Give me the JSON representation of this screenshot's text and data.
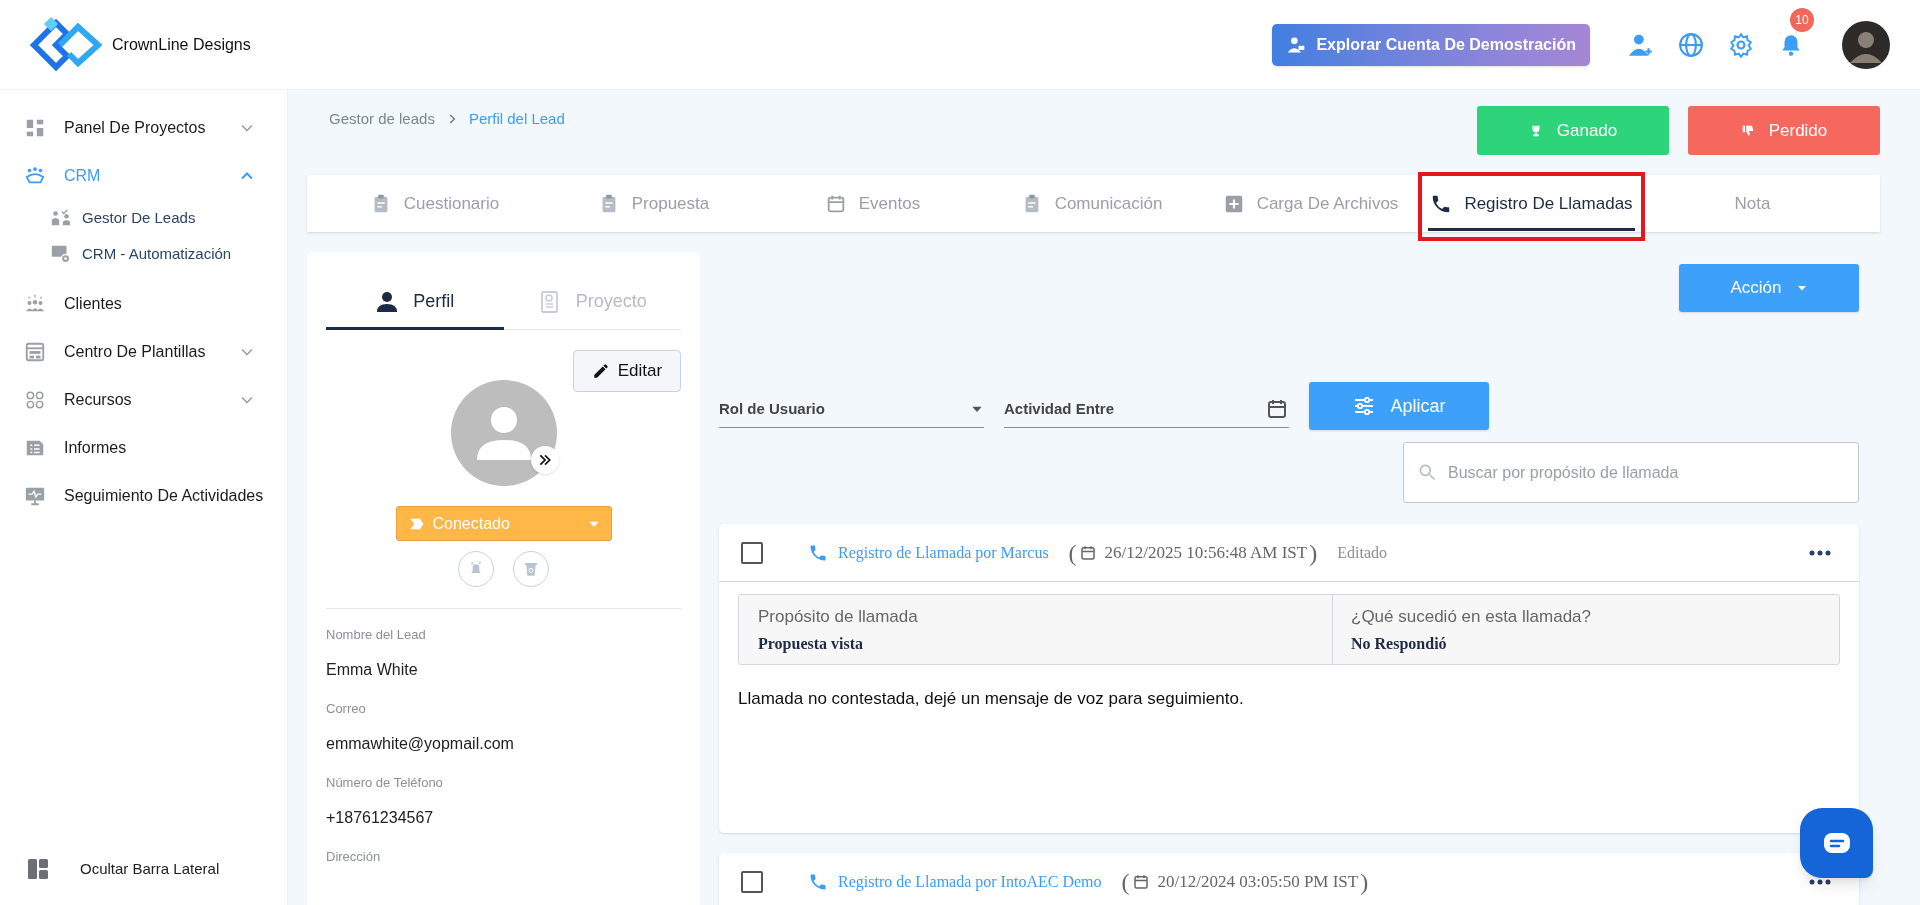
{
  "brand": {
    "name": "CrownLine Designs"
  },
  "header": {
    "demo_button": "Explorar Cuenta De Demostración",
    "notification_count": "10"
  },
  "sidebar": {
    "items": [
      {
        "label": "Panel De Proyectos",
        "kind": "group",
        "expanded": false,
        "selected": false
      },
      {
        "label": "CRM",
        "kind": "group",
        "expanded": true,
        "selected": true,
        "children": [
          {
            "label": "Gestor De Leads"
          },
          {
            "label": "CRM - Automatización"
          }
        ]
      },
      {
        "label": "Clientes",
        "kind": "link",
        "selected": false
      },
      {
        "label": "Centro De Plantillas",
        "kind": "group",
        "expanded": false,
        "selected": false
      },
      {
        "label": "Recursos",
        "kind": "group",
        "expanded": false,
        "selected": false
      },
      {
        "label": "Informes",
        "kind": "link",
        "selected": false
      },
      {
        "label": "Seguimiento De Actividades",
        "kind": "link",
        "selected": false
      }
    ],
    "footer": "Ocultar Barra Lateral"
  },
  "breadcrumb": [
    "Gestor de leads",
    "Perfil del Lead"
  ],
  "actions": {
    "won": "Ganado",
    "lost": "Perdido"
  },
  "tabs": [
    {
      "label": "Cuestionario",
      "selected": false,
      "highlighted": false
    },
    {
      "label": "Propuesta",
      "selected": false,
      "highlighted": false
    },
    {
      "label": "Eventos",
      "selected": false,
      "highlighted": false
    },
    {
      "label": "Comunicación",
      "selected": false,
      "highlighted": false
    },
    {
      "label": "Carga De Archivos",
      "selected": false,
      "highlighted": false
    },
    {
      "label": "Registro De Llamadas",
      "selected": true,
      "highlighted": true
    },
    {
      "label": "Nota",
      "selected": false,
      "highlighted": false
    }
  ],
  "profile": {
    "tabs": [
      {
        "label": "Perfil",
        "selected": true
      },
      {
        "label": "Proyecto",
        "selected": false
      }
    ],
    "edit_button": "Editar",
    "status": "Conectado",
    "fields": [
      {
        "label": "Nombre del Lead",
        "value": "Emma White"
      },
      {
        "label": "Correo",
        "value": "emmawhite@yopmail.com"
      },
      {
        "label": "Número de Teléfono",
        "value": "+18761234567"
      },
      {
        "label": "Dirección"
      }
    ]
  },
  "call_log": {
    "action_button": "Acción",
    "role_select": "Rol de Usuario",
    "date_field": "Actividad Entre",
    "apply_button": "Aplicar",
    "search": {
      "placeholder": "Buscar por propósito de llamada"
    },
    "entries": [
      {
        "checked": false,
        "title": "Registro de Llamada por Marcus",
        "bracket_open": "(",
        "date": "26/12/2025 10:56:48 AM IST",
        "bracket_close": ")",
        "edited": true,
        "edited_label": "Editado",
        "purpose_label": "Propósito de llamada",
        "purpose": "Propuesta vista",
        "outcome_label": "¿Qué sucedió en esta llamada?",
        "outcome": "No Respondió",
        "note": "Llamada no contestada, dejé un mensaje de voz para seguimiento."
      },
      {
        "checked": false,
        "title": "Registro de Llamada por IntoAEC Demo",
        "bracket_open": "(",
        "date": "20/12/2024 03:05:50 PM IST",
        "bracket_close": ")",
        "edited": false
      }
    ]
  }
}
